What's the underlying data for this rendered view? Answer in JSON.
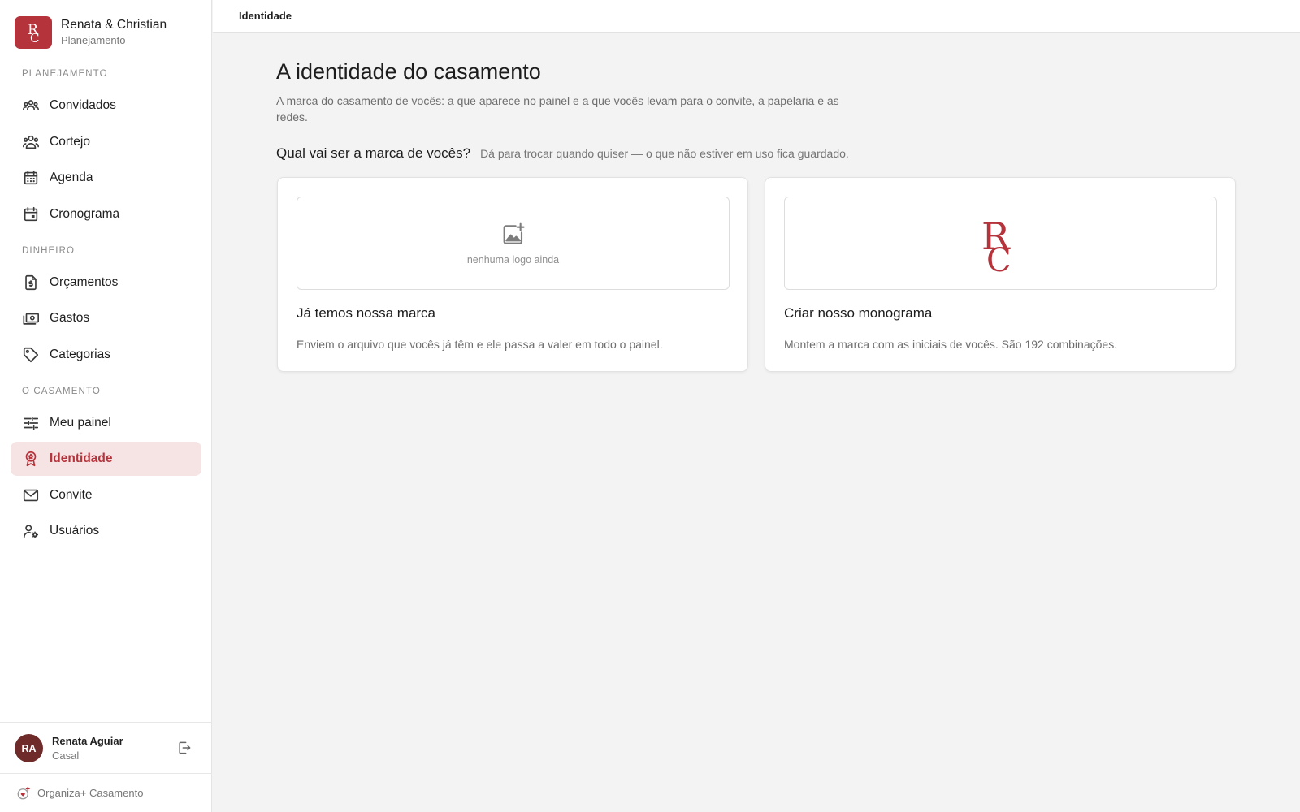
{
  "brand": {
    "name": "Renata & Christian",
    "subtitle": "Planejamento",
    "logo_icon": "rc-monogram",
    "accent_color": "#b5333b"
  },
  "sidebar": {
    "sections": [
      {
        "label": "PLANEJAMENTO",
        "items": [
          {
            "label": "Convidados",
            "icon": "guests-icon"
          },
          {
            "label": "Cortejo",
            "icon": "procession-icon"
          },
          {
            "label": "Agenda",
            "icon": "calendar-icon"
          },
          {
            "label": "Cronograma",
            "icon": "calendar-event-icon"
          }
        ]
      },
      {
        "label": "DINHEIRO",
        "items": [
          {
            "label": "Orçamentos",
            "icon": "budget-icon"
          },
          {
            "label": "Gastos",
            "icon": "money-icon"
          },
          {
            "label": "Categorias",
            "icon": "tag-icon"
          }
        ]
      },
      {
        "label": "O CASAMENTO",
        "items": [
          {
            "label": "Meu painel",
            "icon": "sliders-icon"
          },
          {
            "label": "Identidade",
            "icon": "badge-icon",
            "active": true
          },
          {
            "label": "Convite",
            "icon": "mail-icon"
          },
          {
            "label": "Usuários",
            "icon": "user-settings-icon"
          }
        ]
      }
    ]
  },
  "user": {
    "initials": "RA",
    "name": "Renata Aguiar",
    "role": "Casal"
  },
  "footer": {
    "text": "Organiza+ Casamento"
  },
  "topbar": {
    "breadcrumb": "Identidade"
  },
  "main": {
    "title": "A identidade do casamento",
    "description": "A marca do casamento de vocês: a que aparece no painel e a que vocês levam para o convite, a papelaria e as redes.",
    "question": "Qual vai ser a marca de vocês?",
    "question_hint": "Dá para trocar quando quiser — o que não estiver em uso fica guardado.",
    "cards": [
      {
        "title": "Já temos nossa marca",
        "description": "Enviem o arquivo que vocês já têm e ele passa a valer em todo o painel.",
        "empty_label": "nenhuma logo ainda"
      },
      {
        "title": "Criar nosso monograma",
        "description": "Montem a marca com as iniciais de vocês. São 192 combinações."
      }
    ]
  }
}
